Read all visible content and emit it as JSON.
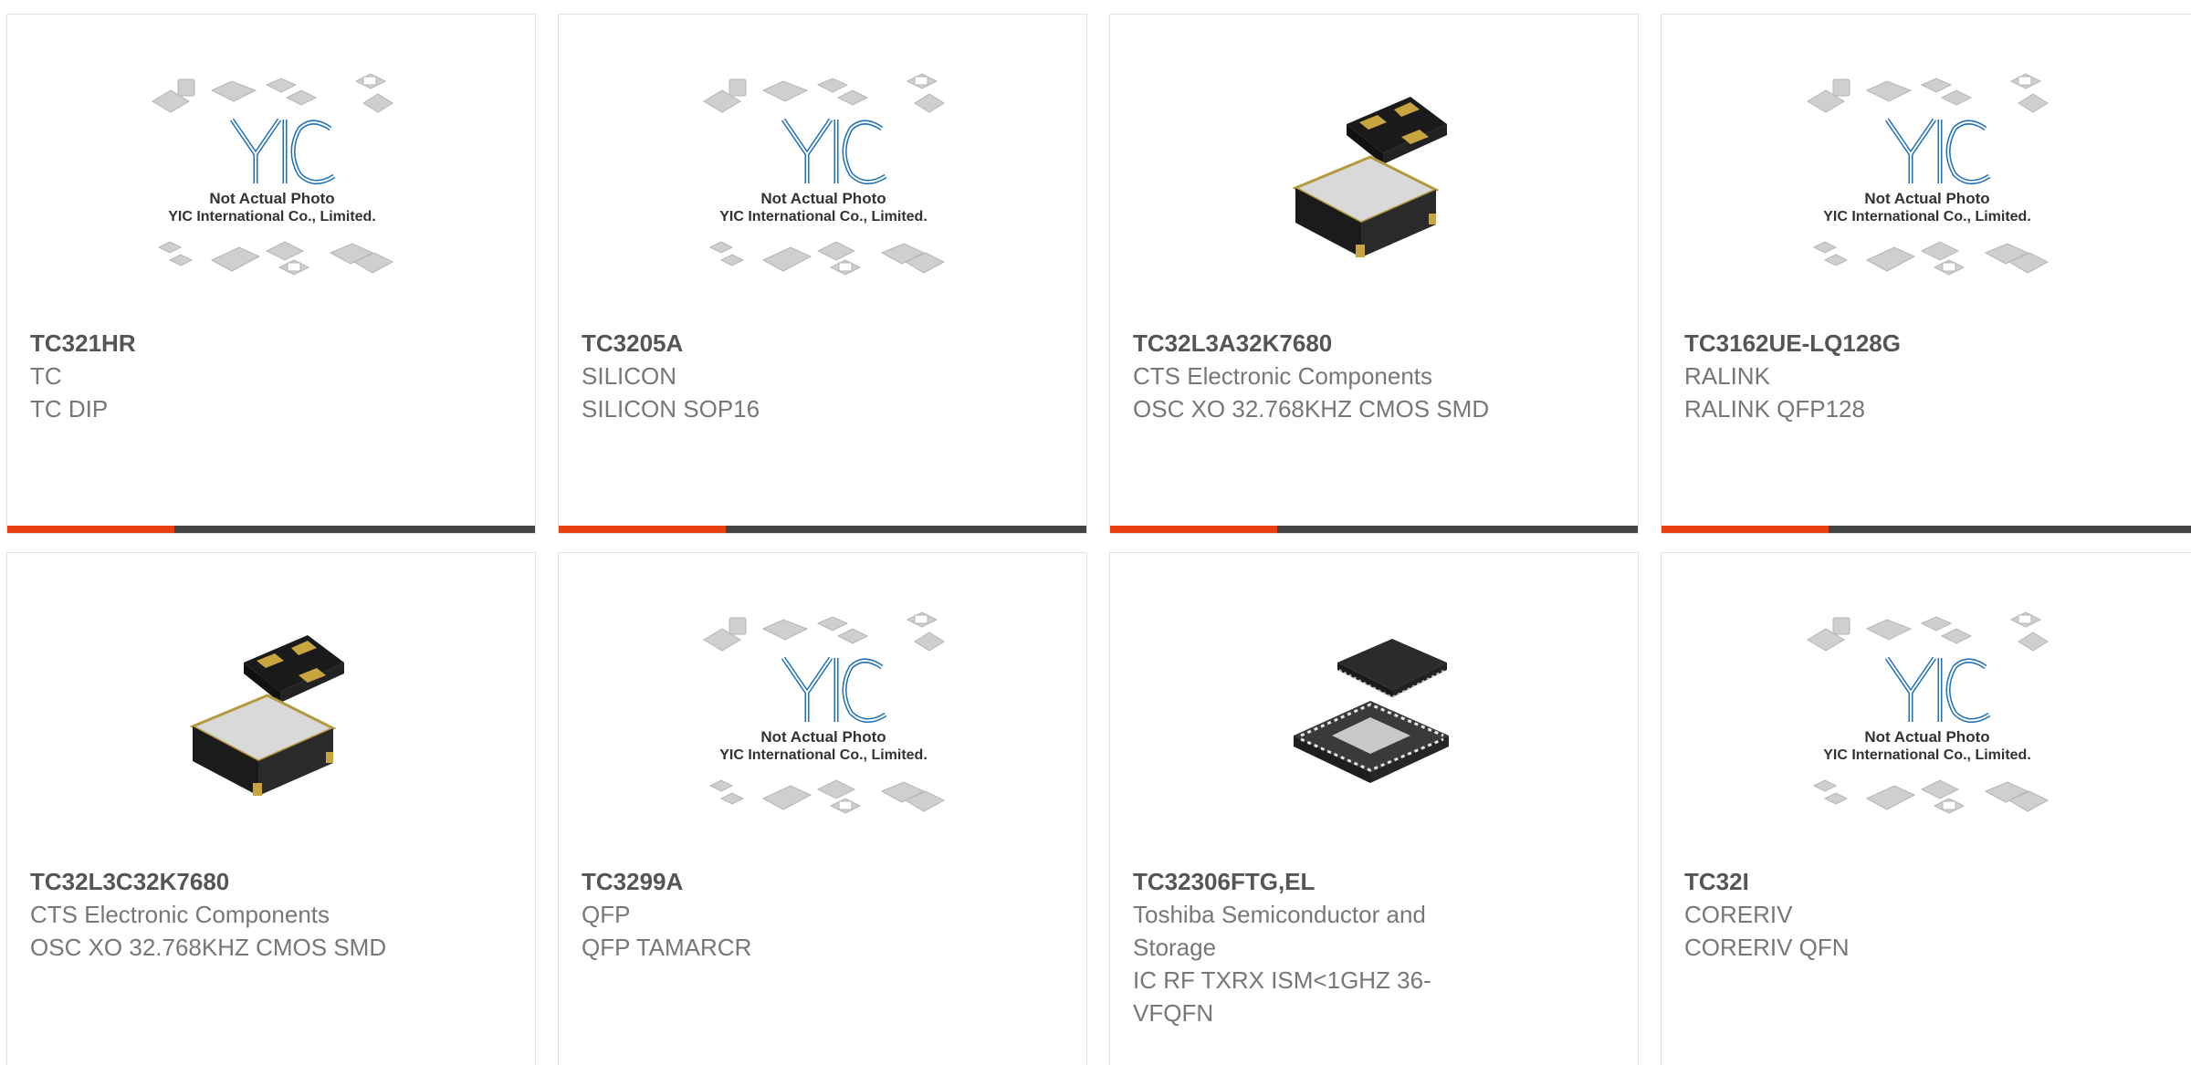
{
  "products": [
    {
      "part": "TC321HR",
      "manufacturer": "TC",
      "description": "TC DIP",
      "image": "placeholder"
    },
    {
      "part": "TC3205A",
      "manufacturer": "SILICON",
      "description": "SILICON SOP16",
      "image": "placeholder"
    },
    {
      "part": "TC32L3A32K7680",
      "manufacturer": "CTS Electronic Components",
      "description": "OSC XO 32.768KHZ CMOS SMD",
      "image": "oscillator"
    },
    {
      "part": "TC3162UE-LQ128G",
      "manufacturer": "RALINK",
      "description": "RALINK QFP128",
      "image": "placeholder"
    },
    {
      "part": "TC32L3C32K7680",
      "manufacturer": "CTS Electronic Components",
      "description": "OSC XO 32.768KHZ CMOS SMD",
      "image": "oscillator"
    },
    {
      "part": "TC3299A",
      "manufacturer": "QFP",
      "description": "QFP TAMARCR",
      "image": "placeholder"
    },
    {
      "part": "TC32306FTG,EL",
      "manufacturer": "Toshiba Semiconductor and Storage",
      "description": "IC RF TXRX ISM<1GHZ 36-VFQFN",
      "image": "qfn"
    },
    {
      "part": "TC32I",
      "manufacturer": "CORERIV",
      "description": "CORERIV QFN",
      "image": "placeholder"
    }
  ],
  "placeholder": {
    "logo": "YIC",
    "line1": "Not Actual Photo",
    "line2": "YIC International Co., Limited."
  },
  "colors": {
    "accent": "#e8410f",
    "bar": "#444444",
    "logo_blue": "#1f6fb5"
  }
}
